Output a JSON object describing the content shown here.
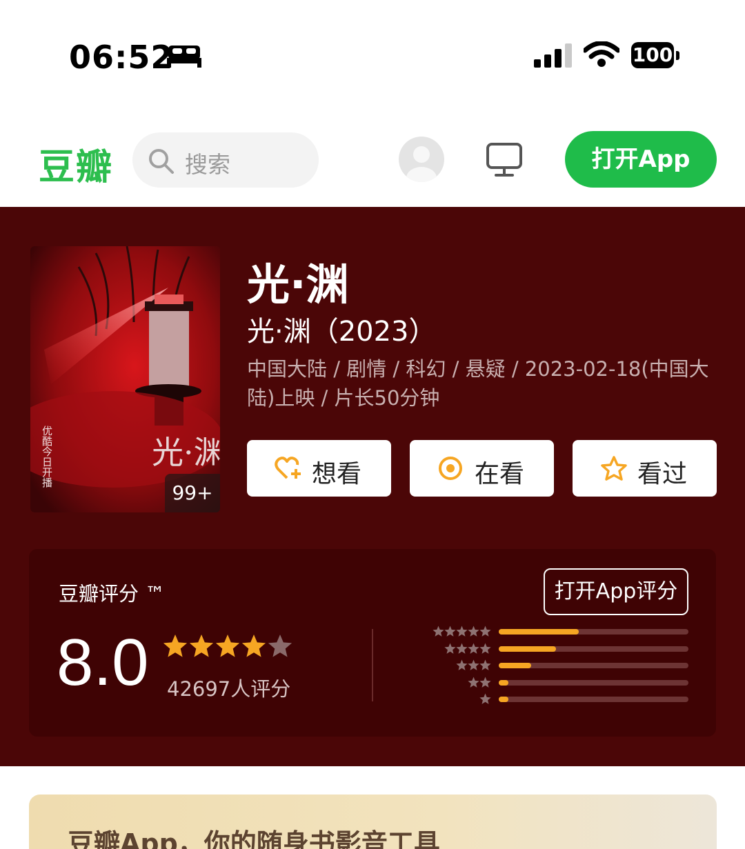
{
  "status_bar": {
    "time": "06:52",
    "battery": "100"
  },
  "header": {
    "logo": "豆瓣",
    "search_placeholder": "搜索",
    "open_app_label": "打开App"
  },
  "movie": {
    "title": "光·渊",
    "subtitle": "光·渊（2023）",
    "meta": "中国大陆 / 剧情 / 科幻 / 悬疑 / 2023-02-18(中国大陆)上映 / 片长50分钟",
    "poster_badge": "99+",
    "poster_title": "光·渊",
    "poster_side_text": "优酷今日开播"
  },
  "actions": [
    {
      "label": "想看",
      "icon": "heart-plus-icon"
    },
    {
      "label": "在看",
      "icon": "target-icon"
    },
    {
      "label": "看过",
      "icon": "star-outline-icon"
    }
  ],
  "rating": {
    "title": "豆瓣评分 ™",
    "open_app_rate_label": "打开App评分",
    "score": "8.0",
    "score_stars": 4,
    "count_text": "42697人评分",
    "distribution": [
      {
        "stars": 5,
        "fraction": 0.42
      },
      {
        "stars": 4,
        "fraction": 0.3
      },
      {
        "stars": 3,
        "fraction": 0.17
      },
      {
        "stars": 2,
        "fraction": 0.05
      },
      {
        "stars": 1,
        "fraction": 0.05
      }
    ]
  },
  "banner": {
    "text": "豆瓣App，你的随身书影音工具"
  },
  "colors": {
    "brand_green": "#2dbe4e",
    "hero_bg": "#4b0607",
    "star": "#f6a623"
  }
}
